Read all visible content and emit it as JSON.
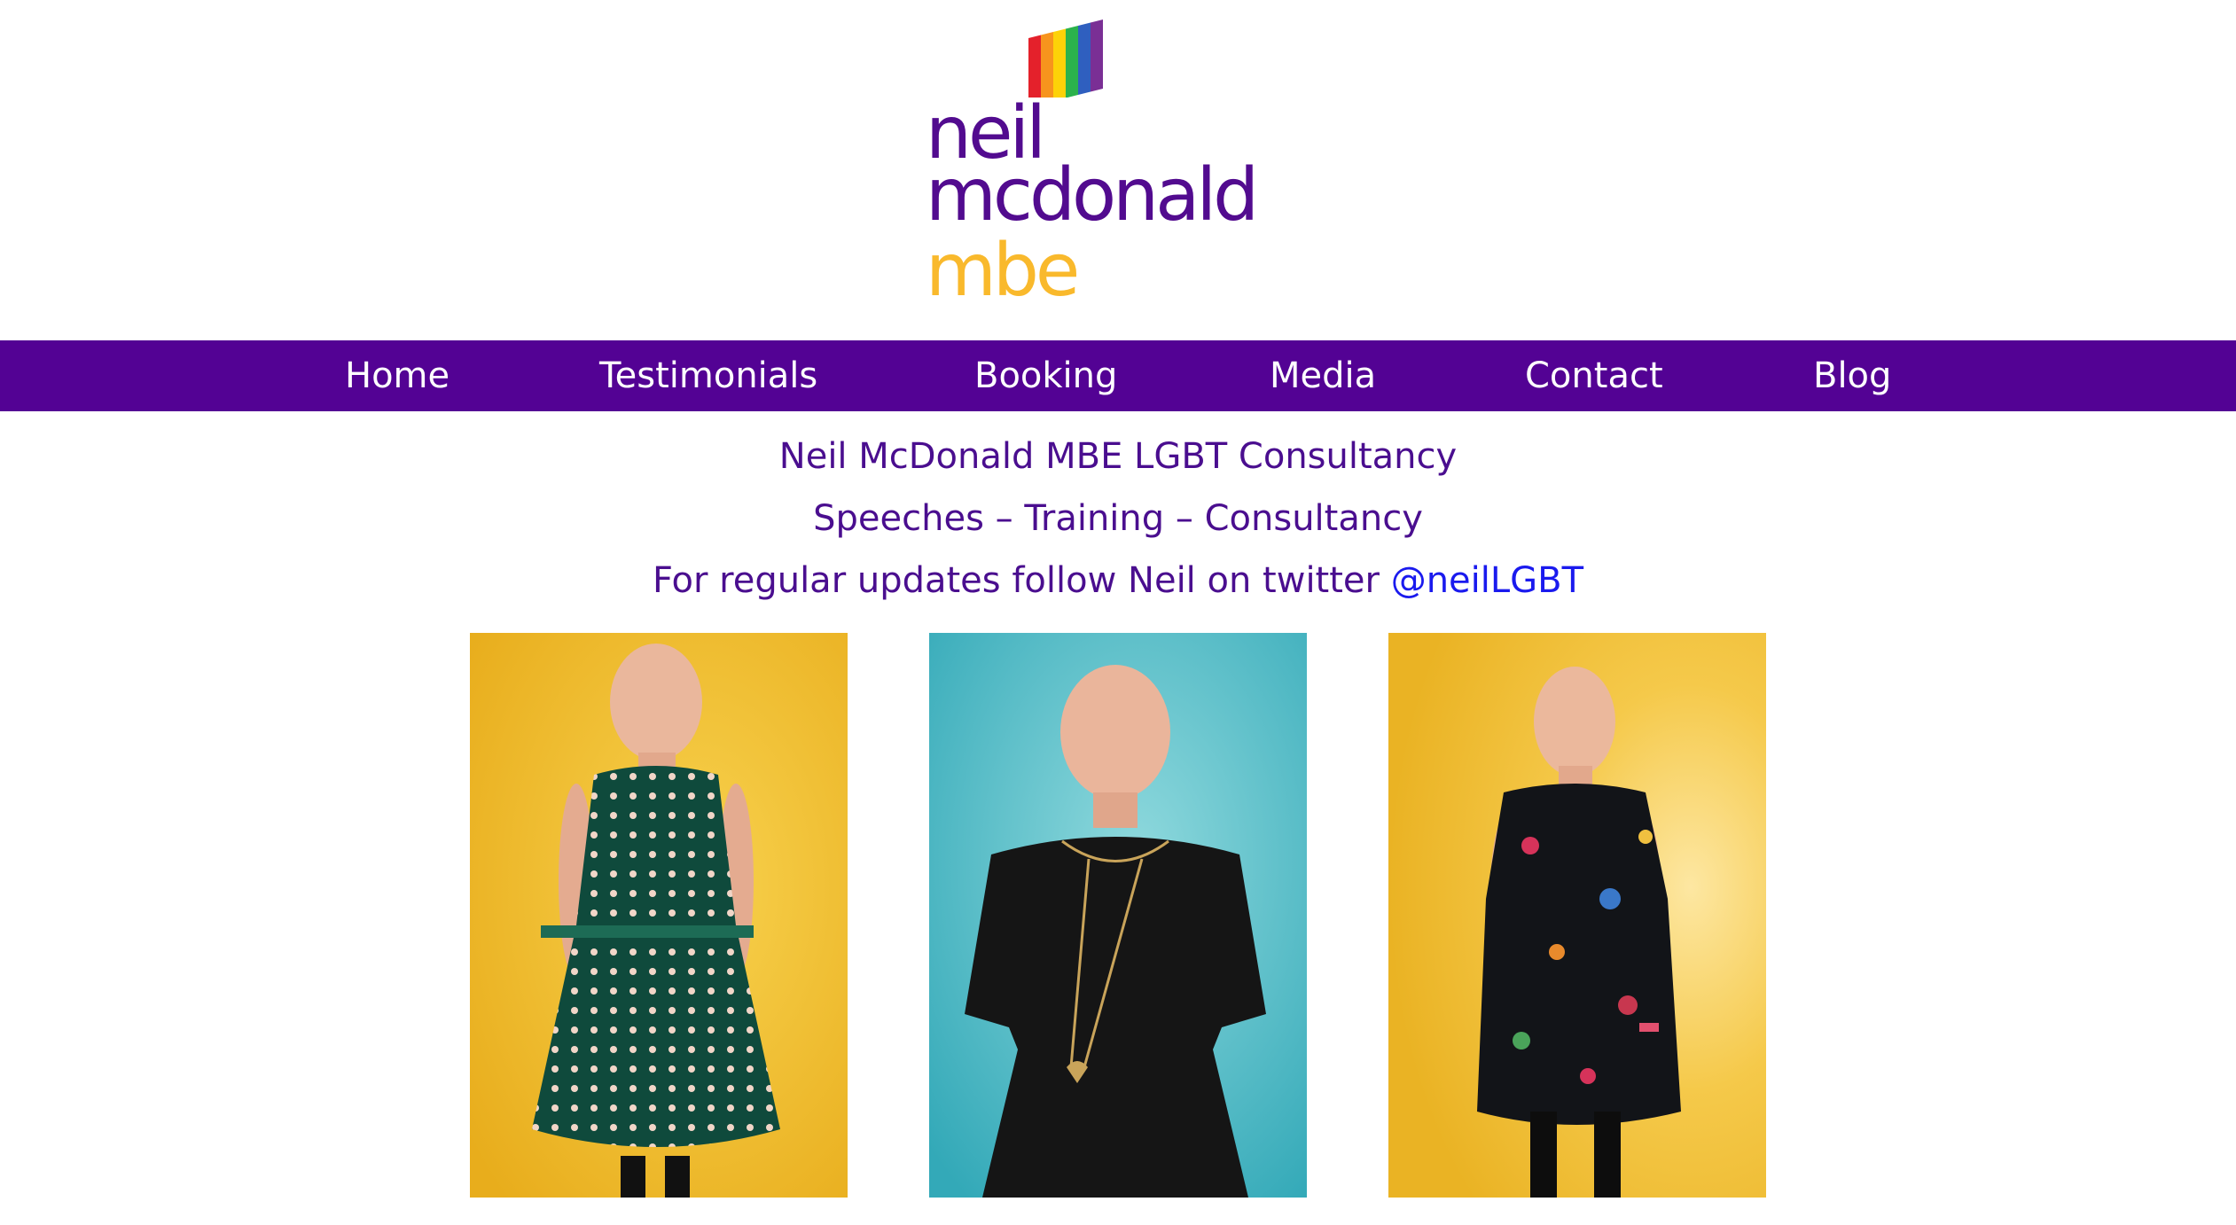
{
  "brand": {
    "logo_line1": "neil",
    "logo_line2": "mcdonald",
    "logo_line3": "mbe",
    "primary_color": "#530294",
    "accent_color": "#f9b92c",
    "flag_icon": "rainbow-flag-icon"
  },
  "nav": {
    "items": [
      {
        "label": "Home"
      },
      {
        "label": "Testimonials"
      },
      {
        "label": "Booking"
      },
      {
        "label": "Media"
      },
      {
        "label": "Contact"
      },
      {
        "label": "Blog"
      }
    ]
  },
  "intro": {
    "line1": "Neil McDonald MBE LGBT Consultancy",
    "line2": "Speeches – Training – Consultancy",
    "line3_prefix": "For regular updates follow Neil on twitter ",
    "twitter_handle": "@neilLGBT"
  },
  "photos": [
    {
      "background": "#f2c12e",
      "dress": "green heart-pattern dress"
    },
    {
      "background": "#5cc3cf",
      "dress": "black dress with heart pendant"
    },
    {
      "background": "#f4c232",
      "dress": "black floral dress"
    }
  ]
}
